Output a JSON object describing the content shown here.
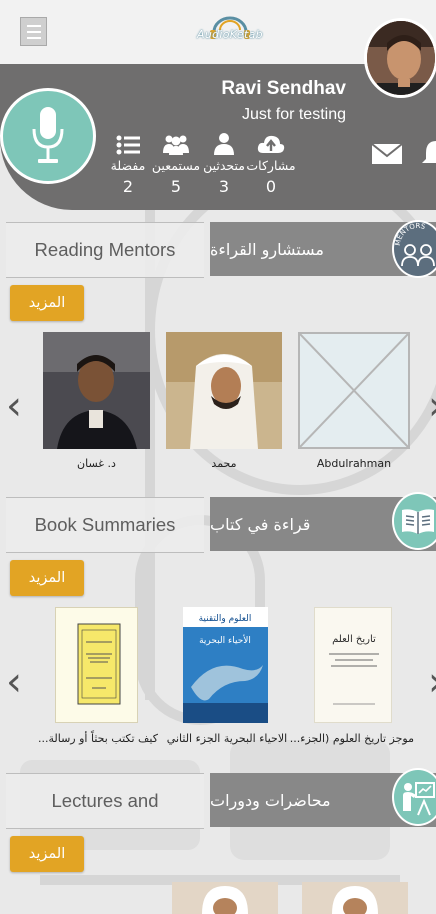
{
  "app": {
    "logo_text": "AudioKetab"
  },
  "profile": {
    "name": "Ravi Sendhav",
    "status": "Just for testing",
    "stats": [
      {
        "label": "مشاركات",
        "value": "0",
        "icon": "upload-cloud-icon"
      },
      {
        "label": "متحدثين",
        "value": "3",
        "icon": "speaker-person-icon"
      },
      {
        "label": "مستمعين",
        "value": "5",
        "icon": "listeners-group-icon"
      },
      {
        "label": "مفضلة",
        "value": "2",
        "icon": "favorites-list-icon"
      }
    ]
  },
  "sections": {
    "mentors": {
      "title_en": "Reading Mentors",
      "title_ar": "مستشارو القراءة",
      "badge_text": "MENTORS",
      "more_label": "المزيد",
      "items": [
        {
          "caption": "Abdulrahman"
        },
        {
          "caption": "محمد"
        },
        {
          "caption": "د. غسان"
        }
      ]
    },
    "summaries": {
      "title_en": "Book Summaries",
      "title_ar": "قراءة في كتاب",
      "more_label": "المزيد",
      "items": [
        {
          "caption": "موجز تاريخ العلوم (الجزء..."
        },
        {
          "caption": "الاحياء البحرية الجزء الثاني"
        },
        {
          "caption": "كيف تكتب بحثاً أو رسالة..."
        }
      ],
      "cover_texts": {
        "book1_title": "تاريخ العلم",
        "book2_header": "العلوم والتقنية",
        "book2_title": "الأحياء البحرية"
      }
    },
    "lectures": {
      "title_en": "Lectures and",
      "title_ar": "محاضرات ودورات",
      "more_label": "المزيد"
    }
  },
  "colors": {
    "header_gray": "#6f6e6e",
    "section_gray": "#888888",
    "accent_teal": "#7ec6b8",
    "more_button": "#e2a424"
  }
}
